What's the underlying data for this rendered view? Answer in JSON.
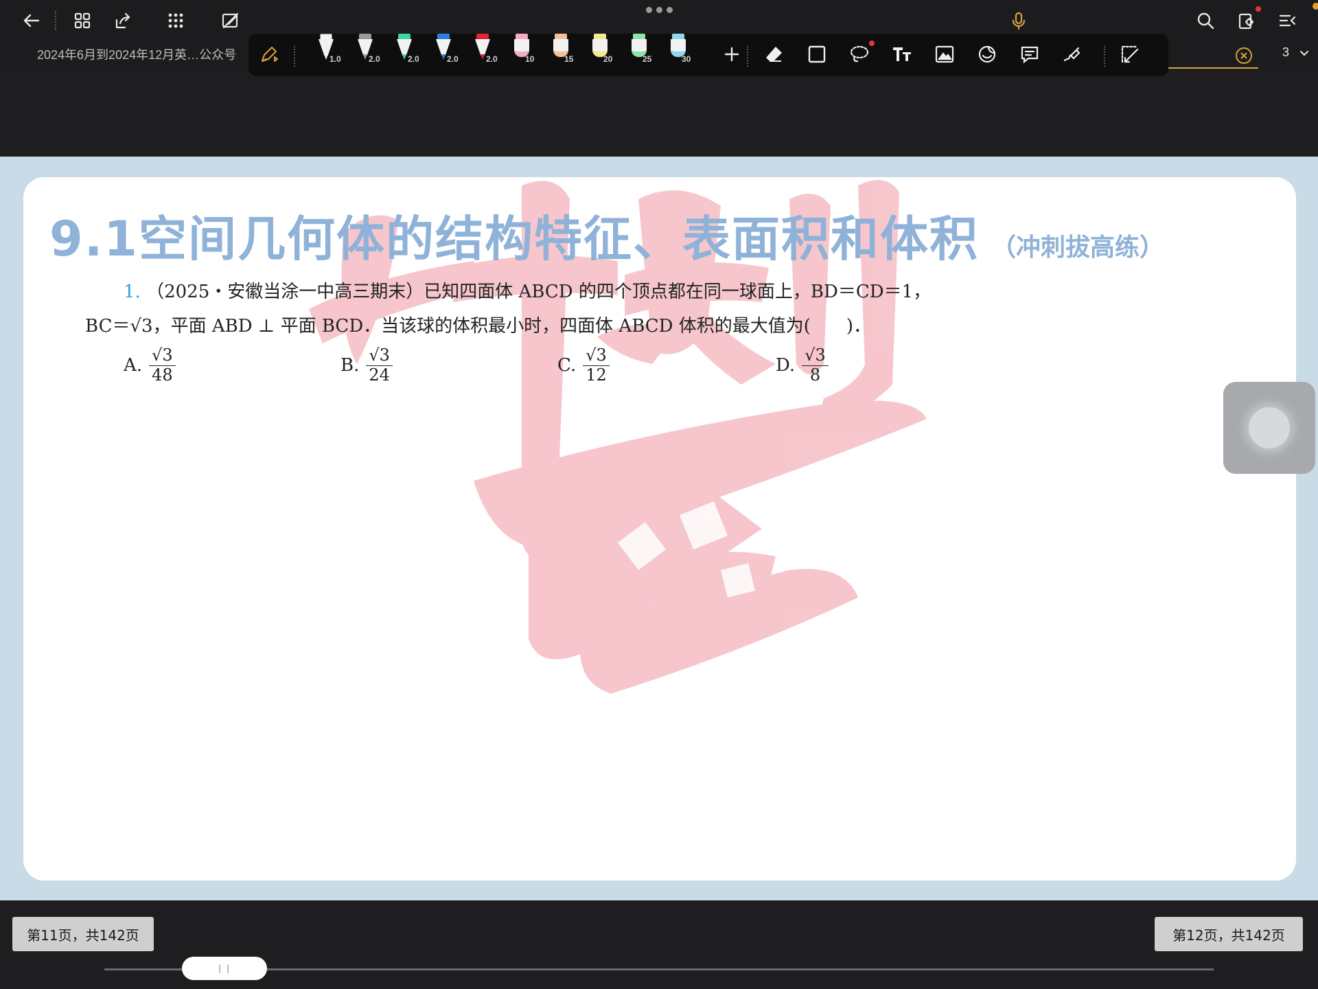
{
  "doc": {
    "title": "2024年6月到2024年12月英…公众号",
    "page_number": "3"
  },
  "pen_toolbar": {
    "pens": [
      {
        "size": "1.0",
        "color": "#f4f4f4",
        "kind": "pen"
      },
      {
        "size": "2.0",
        "color": "#9a9a9a",
        "kind": "pen"
      },
      {
        "size": "2.0",
        "color": "#3dd6a2",
        "kind": "pen"
      },
      {
        "size": "2.0",
        "color": "#2f7fe0",
        "kind": "pen"
      },
      {
        "size": "2.0",
        "color": "#e0243a",
        "kind": "pen"
      },
      {
        "size": "10",
        "color": "#f5a9c8",
        "kind": "marker"
      },
      {
        "size": "15",
        "color": "#f6c09a",
        "kind": "marker"
      },
      {
        "size": "20",
        "color": "#f3ea8c",
        "kind": "marker"
      },
      {
        "size": "25",
        "color": "#8ee3a6",
        "kind": "marker"
      },
      {
        "size": "30",
        "color": "#8fd8ee",
        "kind": "marker"
      }
    ]
  },
  "content": {
    "heading": "9.1空间几何体的结构特征、表面积和体积",
    "heading_sub": "（冲刺拔高练）",
    "question_number": "1.",
    "question_line1": "（2025・安徽当涂一中高三期末）已知四面体 ABCD 的四个顶点都在同一球面上，BD＝CD＝1，",
    "question_line2": "BC＝√3，平面 ABD ⊥ 平面 BCD．当该球的体积最小时，四面体 ABCD 体积的最大值为(　　)．",
    "options": [
      {
        "label": "A.",
        "num": "√3",
        "den": "48"
      },
      {
        "label": "B.",
        "num": "√3",
        "den": "24"
      },
      {
        "label": "C.",
        "num": "√3",
        "den": "12"
      },
      {
        "label": "D.",
        "num": "√3",
        "den": "8"
      }
    ],
    "watermark_text": "冲刺985"
  },
  "footer": {
    "left_page": "第11页，共142页",
    "right_page": "第12页，共142页",
    "slider_progress": 0.07
  },
  "colors": {
    "heading": "#8fb2d9",
    "question_number": "#2aa2d8",
    "accent": "#d9a43a",
    "watermark": "#f3b4bc"
  }
}
